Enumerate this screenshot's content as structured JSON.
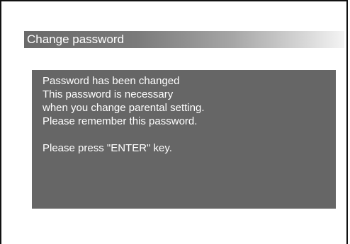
{
  "dialog": {
    "title": "Change password",
    "message_lines": [
      "Password has been changed",
      "This password is necessary",
      "when you change parental setting.",
      "Please remember this password."
    ],
    "instruction": "Please press \"ENTER\" key."
  },
  "colors": {
    "frame_border": "#111111",
    "title_gradient_start": "#6a6a6a",
    "message_box_bg": "#666666",
    "text": "#ffffff"
  }
}
